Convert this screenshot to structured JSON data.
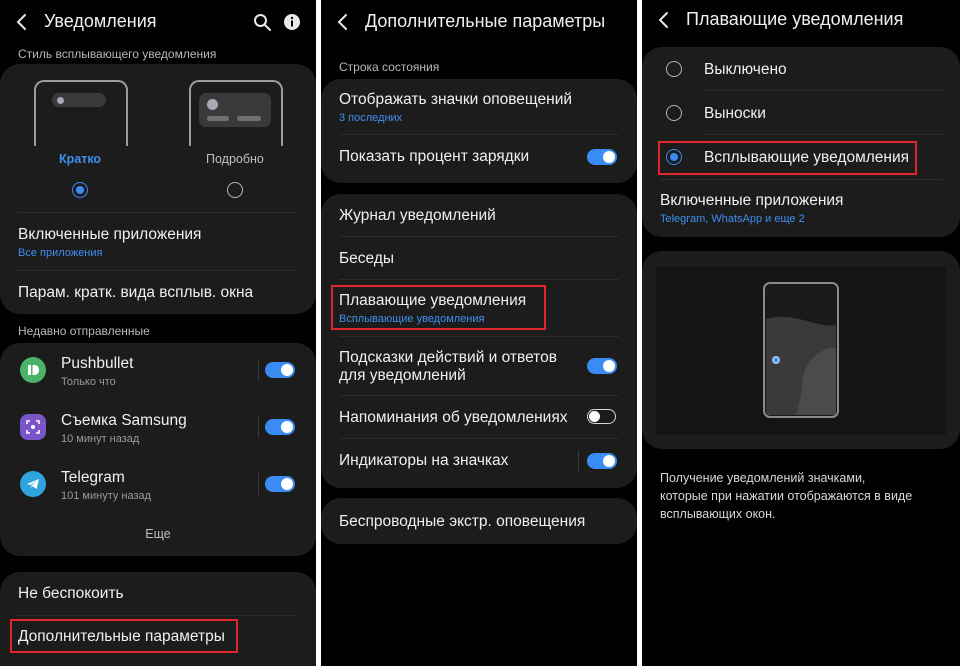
{
  "screen1": {
    "title": "Уведомления",
    "section_style": "Стиль всплывающего уведомления",
    "style_brief": "Кратко",
    "style_detailed": "Подробно",
    "enabled_apps": {
      "label": "Включенные приложения",
      "value": "Все приложения"
    },
    "brief_popup_settings": "Парам. кратк. вида всплыв. окна",
    "section_recent": "Недавно отправленные",
    "apps": [
      {
        "name": "Pushbullet",
        "time": "Только что"
      },
      {
        "name": "Съемка Samsung",
        "time": "10 минут назад"
      },
      {
        "name": "Telegram",
        "time": "101 минуту назад"
      }
    ],
    "more": "Еще",
    "dnd": "Не беспокоить",
    "advanced": "Дополнительные параметры"
  },
  "screen2": {
    "title": "Дополнительные параметры",
    "section_status": "Строка состояния",
    "show_icons": {
      "label": "Отображать значки оповещений",
      "value": "3 последних"
    },
    "battery_percent": "Показать процент зарядки",
    "history": "Журнал уведомлений",
    "conversations": "Беседы",
    "floating": {
      "label": "Плавающие уведомления",
      "value": "Всплывающие уведомления"
    },
    "suggestions_line1": "Подсказки действий и ответов",
    "suggestions_line2": "для уведомлений",
    "reminders": "Напоминания об уведомлениях",
    "badges": "Индикаторы на значках",
    "wireless": "Беспроводные экстр. оповещения"
  },
  "screen3": {
    "title": "Плавающие уведомления",
    "options": [
      "Выключено",
      "Выноски",
      "Всплывающие уведомления"
    ],
    "enabled_apps": {
      "label": "Включенные приложения",
      "value": "Telegram, WhatsApp и еще 2"
    },
    "description_line1": "Получение уведомлений значками,",
    "description_line2": "которые при нажатии отображаются в виде",
    "description_line3": "всплывающих окон."
  },
  "colors": {
    "accent": "#3a8cf2",
    "highlight": "#e0252d",
    "card": "#1c1c1c"
  }
}
